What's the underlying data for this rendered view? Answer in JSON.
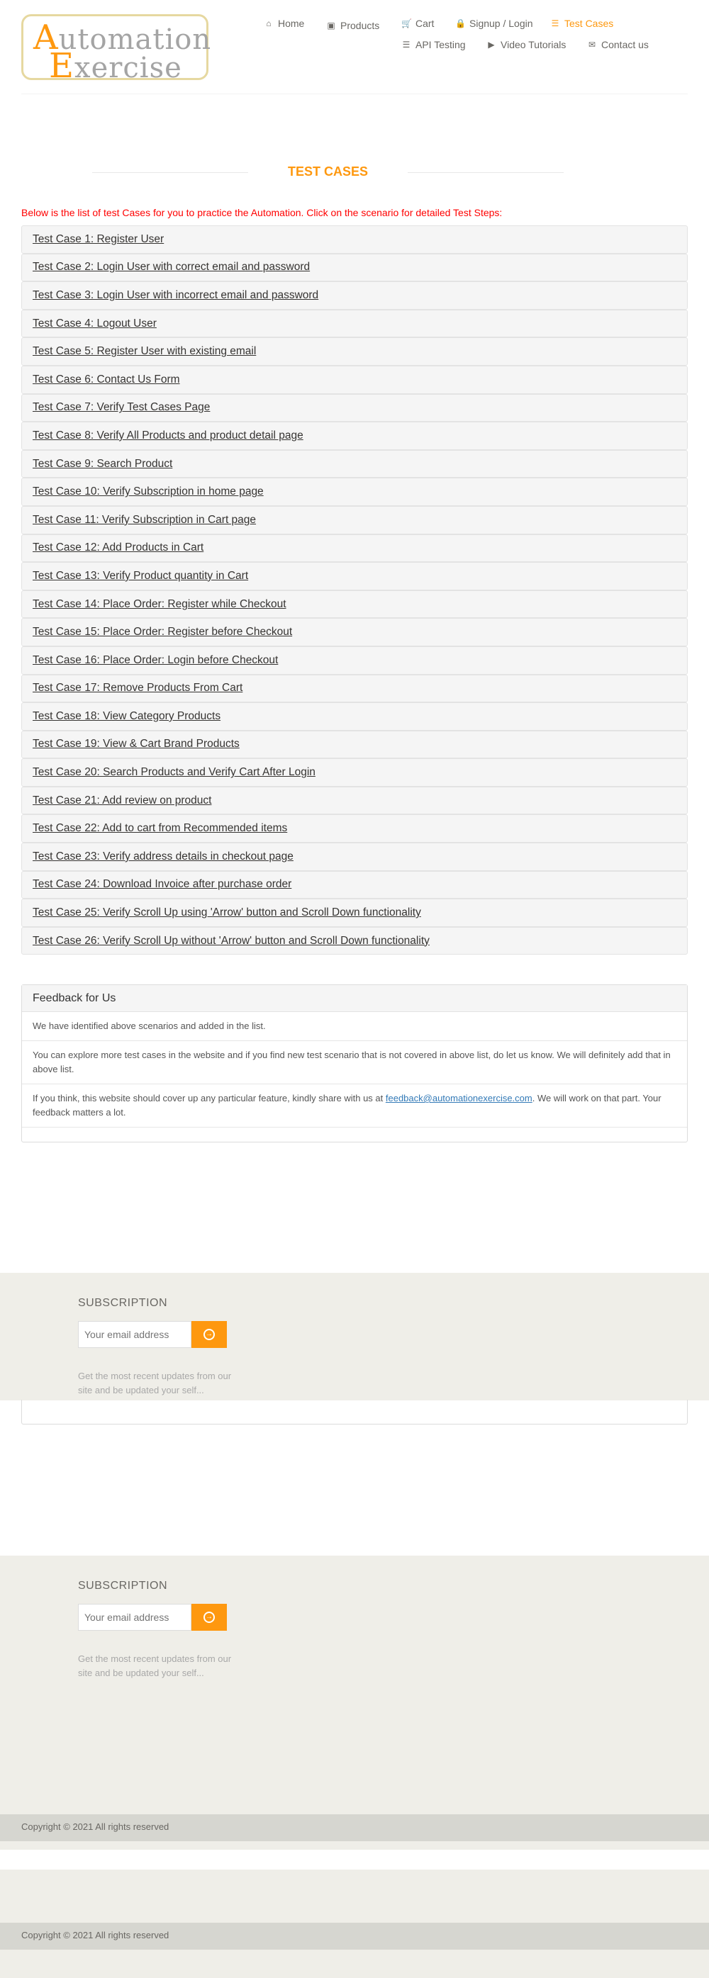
{
  "header": {
    "logo_word1_cap": "A",
    "logo_word1_rest": "utomation",
    "logo_word2_cap": "E",
    "logo_word2_rest": "xercise",
    "nav": {
      "home": "Home",
      "products": "Products",
      "cart": "Cart",
      "signup": "Signup / Login",
      "test_cases": "Test Cases",
      "api_testing": "API Testing",
      "video_tutorials": "Video Tutorials",
      "contact_us": "Contact us"
    },
    "icons": {
      "home": "home-icon",
      "products": "products-icon",
      "cart": "cart-icon",
      "signup": "lock-icon",
      "test_cases": "list-icon",
      "api_testing": "list-icon",
      "video_tutorials": "youtube-icon",
      "contact_us": "envelope-icon"
    }
  },
  "page": {
    "title": "TEST CASES",
    "intro": "Below is the list of test Cases for you to practice the Automation. Click on the scenario for detailed Test Steps:"
  },
  "test_cases": [
    "Test Case 1: Register User",
    "Test Case 2: Login User with correct email and password",
    "Test Case 3: Login User with incorrect email and password",
    "Test Case 4: Logout User",
    "Test Case 5: Register User with existing email",
    "Test Case 6: Contact Us Form",
    "Test Case 7: Verify Test Cases Page",
    "Test Case 8: Verify All Products and product detail page",
    "Test Case 9: Search Product",
    "Test Case 10: Verify Subscription in home page",
    "Test Case 11: Verify Subscription in Cart page",
    "Test Case 12: Add Products in Cart",
    "Test Case 13: Verify Product quantity in Cart",
    "Test Case 14: Place Order: Register while Checkout",
    "Test Case 15: Place Order: Register before Checkout",
    "Test Case 16: Place Order: Login before Checkout",
    "Test Case 17: Remove Products From Cart",
    "Test Case 18: View Category Products",
    "Test Case 19: View & Cart Brand Products",
    "Test Case 20: Search Products and Verify Cart After Login",
    "Test Case 21: Add review on product",
    "Test Case 22: Add to cart from Recommended items",
    "Test Case 23: Verify address details in checkout page",
    "Test Case 24: Download Invoice after purchase order",
    "Test Case 25: Verify Scroll Up using 'Arrow' button and Scroll Down functionality",
    "Test Case 26: Verify Scroll Up without 'Arrow' button and Scroll Down functionality"
  ],
  "feedback": {
    "heading": "Feedback for Us",
    "item1": "We have identified above scenarios and added in the list.",
    "item2": "You can explore more test cases in the website and if you find new test scenario that is not covered in above list, do let us know. We will definitely add that in above list.",
    "item3_before": "If you think, this website should cover up any particular feature, kindly share with us at ",
    "item3_link": "feedback@automationexercise.com",
    "item3_after": ". We will work on that part. Your feedback matters a lot."
  },
  "subscription": {
    "title": "SUBSCRIPTION",
    "placeholder": "Your email address",
    "button_icon": "arrow-circle-right-icon",
    "desc": "Get the most recent updates from our site and be updated your self..."
  },
  "footer": {
    "copyright": "Copyright © 2021 All rights reserved"
  },
  "colors": {
    "accent": "#fe980f",
    "intro_red": "#ff0000",
    "footer_bg": "#efeee8",
    "copyright_bg": "#d6d6d0"
  }
}
